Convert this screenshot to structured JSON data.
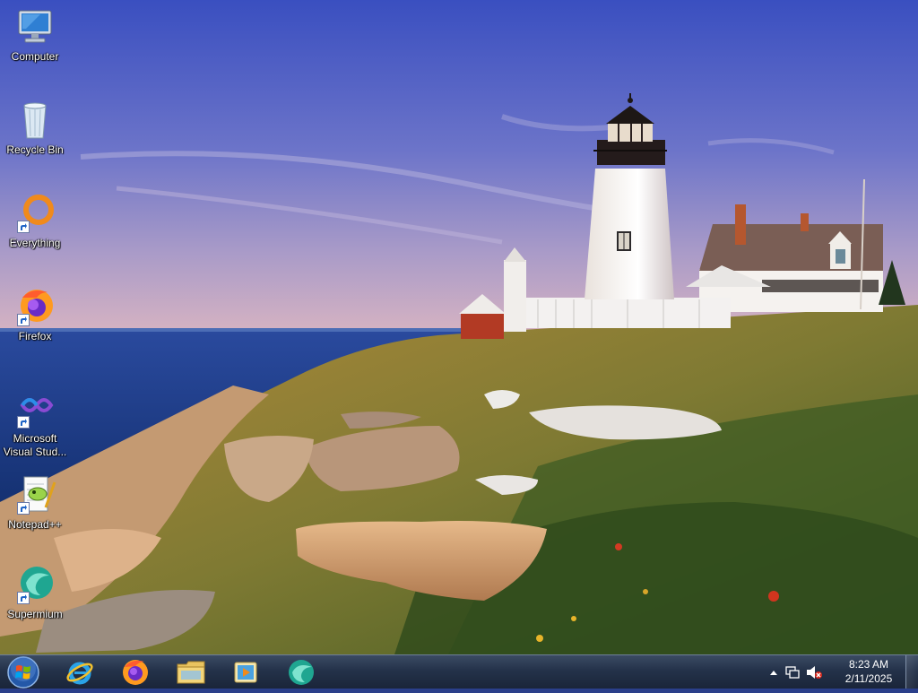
{
  "desktop": {
    "icons": [
      {
        "label_line1": "Computer",
        "label_line2": "",
        "icon": "computer-icon",
        "shortcut": false
      },
      {
        "label_line1": "Recycle Bin",
        "label_line2": "",
        "icon": "recycle-bin-icon",
        "shortcut": false
      },
      {
        "label_line1": "Everything",
        "label_line2": "",
        "icon": "everything-icon",
        "shortcut": true
      },
      {
        "label_line1": "Firefox",
        "label_line2": "",
        "icon": "firefox-icon",
        "shortcut": true
      },
      {
        "label_line1": "Microsoft",
        "label_line2": "Visual Stud...",
        "icon": "visual-studio-icon",
        "shortcut": true
      },
      {
        "label_line1": "Notepad++",
        "label_line2": "",
        "icon": "notepad-plus-plus-icon",
        "shortcut": true
      },
      {
        "label_line1": "Supermium",
        "label_line2": "",
        "icon": "supermium-icon",
        "shortcut": true
      }
    ]
  },
  "taskbar": {
    "start_icon": "windows-start-orb-icon",
    "pinned": [
      {
        "name": "Internet Explorer",
        "icon": "internet-explorer-icon"
      },
      {
        "name": "Firefox",
        "icon": "firefox-icon"
      },
      {
        "name": "Windows Explorer",
        "icon": "folder-icon"
      },
      {
        "name": "Windows Media Player",
        "icon": "media-player-icon"
      },
      {
        "name": "Supermium",
        "icon": "supermium-icon"
      }
    ],
    "tray": {
      "show_hidden_icon": "chevron-up-icon",
      "network_icon": "network-icon",
      "volume_icon": "volume-muted-icon",
      "time": "8:23 AM",
      "date": "2/11/2025"
    }
  },
  "colors": {
    "sky_top": "#3f56c4",
    "sky_bottom": "#c9a8c8",
    "sea": "#1d3f8f",
    "taskbar": "#24324a"
  }
}
